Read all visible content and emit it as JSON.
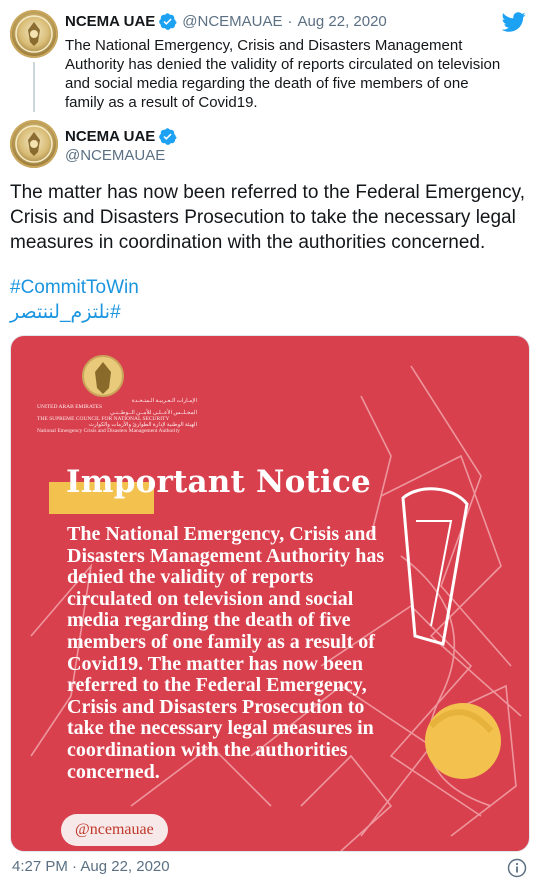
{
  "quoted_tweet": {
    "name": "NCEMA UAE",
    "handle": "@NCEMAUAE",
    "separator": "·",
    "date": "Aug 22, 2020",
    "text": "The National Emergency, Crisis and Disasters Management Authority has denied the validity of reports circulated on television and social media regarding the death of five members of one family as a result of Covid19."
  },
  "tweet": {
    "name": "NCEMA UAE",
    "handle": "@NCEMAUAE",
    "text": "The matter has now been referred to the Federal Emergency, Crisis and Disasters Prosecution to take the necessary legal measures in coordination with the authorities concerned.",
    "hashtags": [
      "#CommitToWin",
      "#نلتزم_لننتصر"
    ],
    "timestamp": "4:27 PM · Aug 22, 2020"
  },
  "media": {
    "org_lines": [
      "الإمـارات الـعـربيـة الـمتـحـدة",
      "UNITED ARAB EMIRATES",
      "المجـلــس الأعــلـى للأمــن الــوطــنـي",
      "THE SUPREME COUNCIL FOR NATIONAL SECURITY",
      "الهيئة الوطنية لإدارة الطوارئ والأزمات والكوارث",
      "National Emergency Crisis and Disasters Management Authority"
    ],
    "title": "Important Notice",
    "body": "The National Emergency, Crisis and Disasters Management Authority has denied the validity of reports circulated on television and social media regarding the death of five members of one family as a result of Covid19. The matter has now been referred to the Federal Emergency, Crisis and Disasters Prosecution to take the necessary legal measures in coordination with the authorities concerned.",
    "footer_handle": "@ncemauae"
  },
  "colors": {
    "accent": "#1b95e0",
    "verified": "#1da1f2",
    "media_background": "#d9404e",
    "highlight_yellow": "#f2c14e"
  },
  "icons": [
    "twitter-bird-icon",
    "verified-badge-icon",
    "info-icon",
    "emblem-icon"
  ]
}
